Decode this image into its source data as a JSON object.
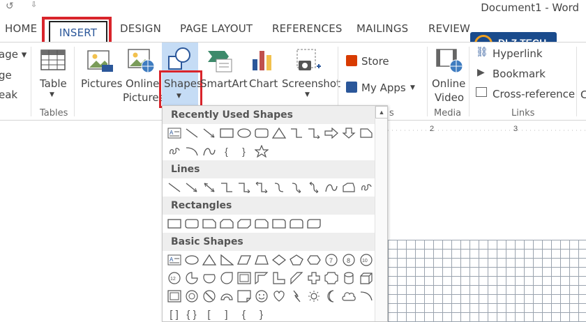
{
  "title": "Document1 - Word",
  "qat": {
    "undo_icon": "↺",
    "more": "⇩"
  },
  "tabs": [
    {
      "label": "HOME"
    },
    {
      "label": "INSERT"
    },
    {
      "label": "DESIGN"
    },
    {
      "label": "PAGE LAYOUT"
    },
    {
      "label": "REFERENCES"
    },
    {
      "label": "MAILINGS"
    },
    {
      "label": "REVIEW"
    }
  ],
  "logo": {
    "text": "DLZ TECH"
  },
  "ribbon": {
    "left_items": [
      "age ▾",
      "ge",
      "eak"
    ],
    "table": {
      "label": "Table",
      "group": "Tables"
    },
    "pictures": {
      "label": "Pictures"
    },
    "online_pictures": {
      "label1": "Online",
      "label2": "Pictures"
    },
    "shapes": {
      "label": "Shapes"
    },
    "smartart": {
      "label": "SmartArt"
    },
    "chart": {
      "label": "Chart"
    },
    "screenshot": {
      "label": "Screenshot"
    },
    "store": {
      "label": "Store"
    },
    "my_apps": {
      "label": "My Apps"
    },
    "apps_group_fragment": "s",
    "online_video": {
      "label1": "Online",
      "label2": "Video",
      "group": "Media"
    },
    "links": {
      "hyperlink": "Hyperlink",
      "bookmark": "Bookmark",
      "cross_reference": "Cross-reference",
      "group": "Links"
    },
    "partial_right": "C"
  },
  "dropdown": {
    "sections": [
      {
        "title": "Recently Used Shapes"
      },
      {
        "title": "Lines"
      },
      {
        "title": "Rectangles"
      },
      {
        "title": "Basic Shapes"
      }
    ],
    "scroll_up": "▲",
    "basic_digits": [
      "7",
      "8",
      "10",
      "12"
    ],
    "braces": [
      "{",
      "}"
    ]
  },
  "ruler": {
    "mark1": "2",
    "mark2": "3"
  },
  "colors": {
    "accent": "#2b579a",
    "highlight": "#d9242b",
    "selected_bg": "#c5dcf5"
  }
}
